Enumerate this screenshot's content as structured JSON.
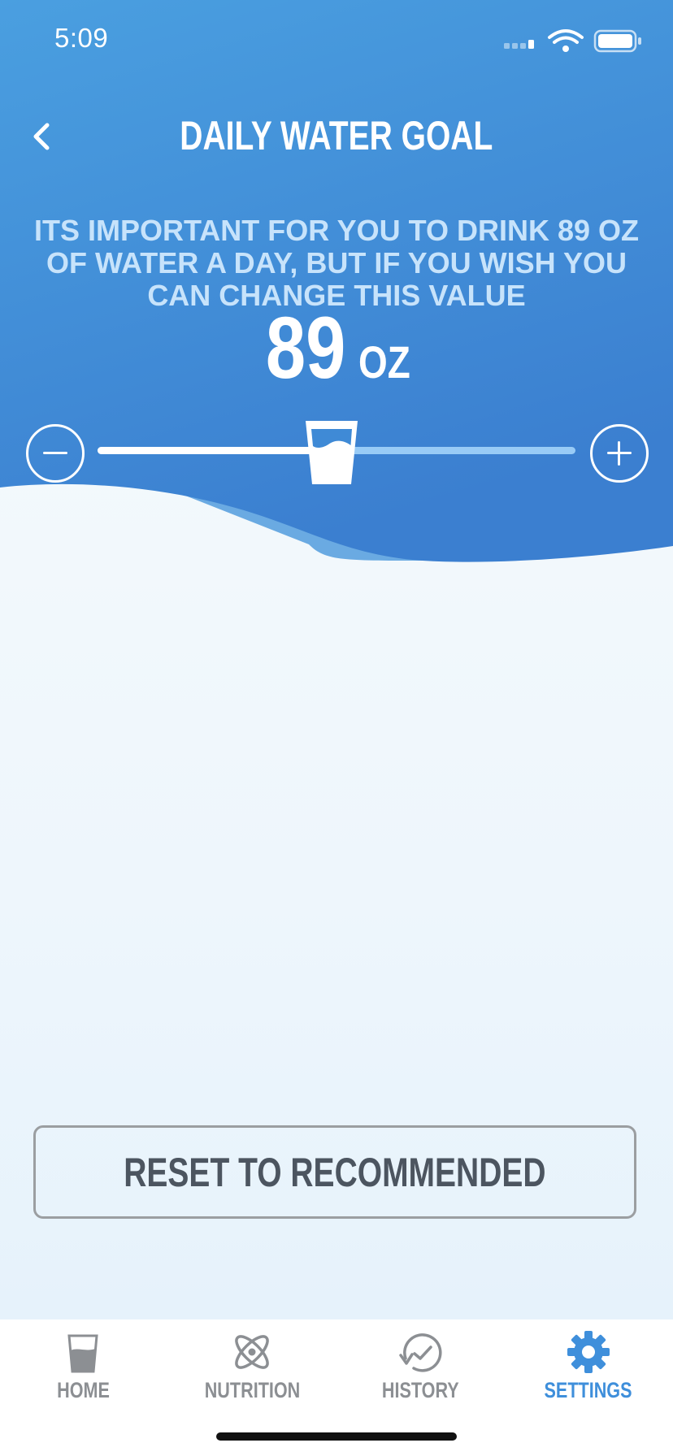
{
  "status_bar": {
    "time": "5:09"
  },
  "header": {
    "title": "DAILY WATER GOAL",
    "back_icon": "chevron-left-icon"
  },
  "goal": {
    "description": "ITS IMPORTANT FOR YOU TO DRINK 89 OZ OF WATER A DAY, BUT IF YOU WISH YOU CAN CHANGE THIS VALUE",
    "value": "89",
    "unit": "OZ",
    "slider_position": 0.49
  },
  "reset_button": {
    "label": "RESET TO RECOMMENDED"
  },
  "tabs": [
    {
      "label": "HOME",
      "icon": "glass-icon",
      "active": false
    },
    {
      "label": "NUTRITION",
      "icon": "atom-icon",
      "active": false
    },
    {
      "label": "HISTORY",
      "icon": "history-icon",
      "active": false
    },
    {
      "label": "SETTINGS",
      "icon": "gear-icon",
      "active": true
    }
  ],
  "colors": {
    "header_top": "#4a9fe0",
    "header_bottom": "#3b7fd0",
    "slider_track": "#98cbf6",
    "tab_inactive": "#8c8f93",
    "tab_active": "#3f8fdb",
    "button_text": "#4c5560"
  }
}
